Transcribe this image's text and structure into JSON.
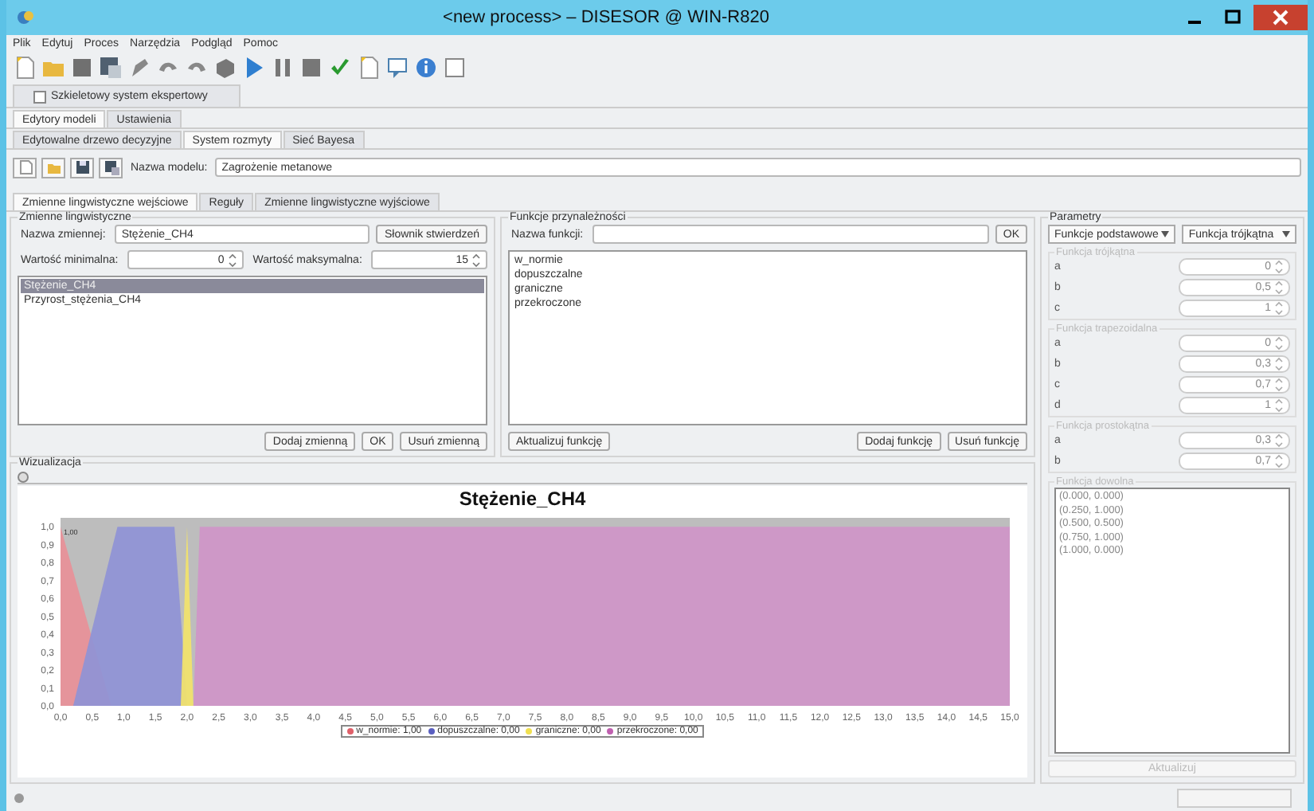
{
  "window": {
    "title": "<new process> – DISESOR @ WIN-R820"
  },
  "menu": [
    "Plik",
    "Edytuj",
    "Proces",
    "Narzędzia",
    "Podgląd",
    "Pomoc"
  ],
  "document_tab": {
    "label": "Szkieletowy system ekspertowy",
    "checked": false
  },
  "editor_tabs": [
    {
      "label": "Edytory modeli",
      "selected": true
    },
    {
      "label": "Ustawienia",
      "selected": false
    }
  ],
  "model_tabs": [
    {
      "label": "Edytowalne drzewo decyzyjne",
      "selected": false
    },
    {
      "label": "System rozmyty",
      "selected": true
    },
    {
      "label": "Sieć Bayesa",
      "selected": false
    }
  ],
  "model": {
    "label": "Nazwa modelu:",
    "value": "Zagrożenie metanowe"
  },
  "variable_tabs": [
    {
      "label": "Zmienne lingwistyczne wejściowe",
      "selected": true
    },
    {
      "label": "Reguły",
      "selected": false
    },
    {
      "label": "Zmienne lingwistyczne wyjściowe",
      "selected": false
    }
  ],
  "variables": {
    "title": "Zmienne lingwistyczne",
    "name_label": "Nazwa zmiennej:",
    "name_value": "Stężenie_CH4",
    "dictionary_button": "Słownik stwierdzeń",
    "min_label": "Wartość minimalna:",
    "min_value": "0",
    "max_label": "Wartość maksymalna:",
    "max_value": "15",
    "items": [
      {
        "label": "Stężenie_CH4",
        "selected": true
      },
      {
        "label": "Przyrost_stężenia_CH4",
        "selected": false
      }
    ],
    "buttons": [
      "Dodaj zmienną",
      "OK",
      "Usuń zmienną"
    ]
  },
  "functions": {
    "title": "Funkcje przynależności",
    "name_label": "Nazwa funkcji:",
    "ok_button": "OK",
    "items": [
      {
        "label": "w_normie",
        "selected": false
      },
      {
        "label": "dopuszczalne",
        "selected": false
      },
      {
        "label": "graniczne",
        "selected": false
      },
      {
        "label": "przekroczone",
        "selected": false
      }
    ],
    "update_button": "Aktualizuj funkcję",
    "buttons": [
      "Dodaj funkcję",
      "Usuń funkcję"
    ]
  },
  "parameters": {
    "title": "Parametry",
    "dropdowns": [
      "Funkcje podstawowe",
      "Funkcja trójkątna"
    ],
    "groups": [
      {
        "title": "Funkcja trójkątna",
        "disabled": true,
        "fields": [
          {
            "label": "a",
            "value": "0"
          },
          {
            "label": "b",
            "value": "0,5"
          },
          {
            "label": "c",
            "value": "1"
          }
        ]
      },
      {
        "title": "Funkcja trapezoidalna",
        "disabled": true,
        "fields": [
          {
            "label": "a",
            "value": "0"
          },
          {
            "label": "b",
            "value": "0,3"
          },
          {
            "label": "c",
            "value": "0,7"
          },
          {
            "label": "d",
            "value": "1"
          }
        ]
      },
      {
        "title": "Funkcja prostokątna",
        "disabled": true,
        "fields": [
          {
            "label": "a",
            "value": "0,3"
          },
          {
            "label": "b",
            "value": "0,7"
          }
        ]
      }
    ],
    "custom": {
      "title": "Funkcja dowolna",
      "disabled": true,
      "points": [
        "(0.000, 0.000)",
        "(0.250, 1.000)",
        "(0.500, 0.500)",
        "(0.750, 1.000)",
        "(1.000, 0.000)"
      ]
    },
    "update_button": {
      "label": "Aktualizuj",
      "disabled": true
    }
  },
  "visualization": {
    "title": "Wizualizacja",
    "legend": [
      {
        "reading": ": 1,00",
        "color": "#e0606a"
      },
      {
        "reading": ": 0,00",
        "color": "#5a5fc0"
      },
      {
        "reading": ": 0,00",
        "color": "#f0e050"
      },
      {
        "reading": ": 0,00",
        "color": "#c060b0"
      }
    ],
    "chart_data": {
      "type": "area",
      "title": "Stężenie_CH4",
      "x": [
        0,
        0.2,
        0.8,
        0.9,
        1.8,
        1.9,
        2.0,
        2.1,
        2.2,
        15
      ],
      "series": [
        {
          "name": "w_normie",
          "color": "#e89098",
          "values": [
            1,
            0.75,
            0,
            null,
            null,
            null,
            null,
            null,
            null,
            null
          ]
        },
        {
          "name": "dopuszczalne",
          "color": "#8f92d6",
          "values": [
            null,
            0,
            0.86,
            1,
            1,
            0.5,
            0,
            null,
            null,
            null
          ]
        },
        {
          "name": "graniczne",
          "color": "#f2e36a",
          "values": [
            null,
            null,
            null,
            null,
            null,
            0,
            1,
            0,
            null,
            null
          ]
        },
        {
          "name": "przekroczone",
          "color": "#cf95c8",
          "values": [
            null,
            null,
            null,
            null,
            null,
            null,
            null,
            0,
            1,
            1
          ]
        }
      ],
      "xlim": [
        0,
        15
      ],
      "ylim": [
        0,
        1.05
      ],
      "xticks": [
        {
          "value": 0,
          "label": "0,0"
        },
        {
          "value": 0.5,
          "label": "0,5"
        },
        {
          "value": 1,
          "label": "1,0"
        },
        {
          "value": 1.5,
          "label": "1,5"
        },
        {
          "value": 2,
          "label": "2,0"
        },
        {
          "value": 2.5,
          "label": "2,5"
        },
        {
          "value": 3,
          "label": "3,0"
        },
        {
          "value": 3.5,
          "label": "3,5"
        },
        {
          "value": 4,
          "label": "4,0"
        },
        {
          "value": 4.5,
          "label": "4,5"
        },
        {
          "value": 5,
          "label": "5,0"
        },
        {
          "value": 5.5,
          "label": "5,5"
        },
        {
          "value": 6,
          "label": "6,0"
        },
        {
          "value": 6.5,
          "label": "6,5"
        },
        {
          "value": 7,
          "label": "7,0"
        },
        {
          "value": 7.5,
          "label": "7,5"
        },
        {
          "value": 8,
          "label": "8,0"
        },
        {
          "value": 8.5,
          "label": "8,5"
        },
        {
          "value": 9,
          "label": "9,0"
        },
        {
          "value": 9.5,
          "label": "9,5"
        },
        {
          "value": 10,
          "label": "10,0"
        },
        {
          "value": 10.5,
          "label": "10,5"
        },
        {
          "value": 11,
          "label": "11,0"
        },
        {
          "value": 11.5,
          "label": "11,5"
        },
        {
          "value": 12,
          "label": "12,0"
        },
        {
          "value": 12.5,
          "label": "12,5"
        },
        {
          "value": 13,
          "label": "13,0"
        },
        {
          "value": 13.5,
          "label": "13,5"
        },
        {
          "value": 14,
          "label": "14,0"
        },
        {
          "value": 14.5,
          "label": "14,5"
        },
        {
          "value": 15,
          "label": "15,0"
        }
      ],
      "yticks": [
        {
          "value": 0,
          "label": "0,0"
        },
        {
          "value": 0.1,
          "label": "0,1"
        },
        {
          "value": 0.2,
          "label": "0,2"
        },
        {
          "value": 0.3,
          "label": "0,3"
        },
        {
          "value": 0.4,
          "label": "0,4"
        },
        {
          "value": 0.5,
          "label": "0,5"
        },
        {
          "value": 0.6,
          "label": "0,6"
        },
        {
          "value": 0.7,
          "label": "0,7"
        },
        {
          "value": 0.8,
          "label": "0,8"
        },
        {
          "value": 0.9,
          "label": "0,9"
        },
        {
          "value": 1,
          "label": "1,0"
        }
      ],
      "annotations": [
        {
          "x": 0,
          "y": 1,
          "text": "1,00"
        }
      ]
    }
  }
}
